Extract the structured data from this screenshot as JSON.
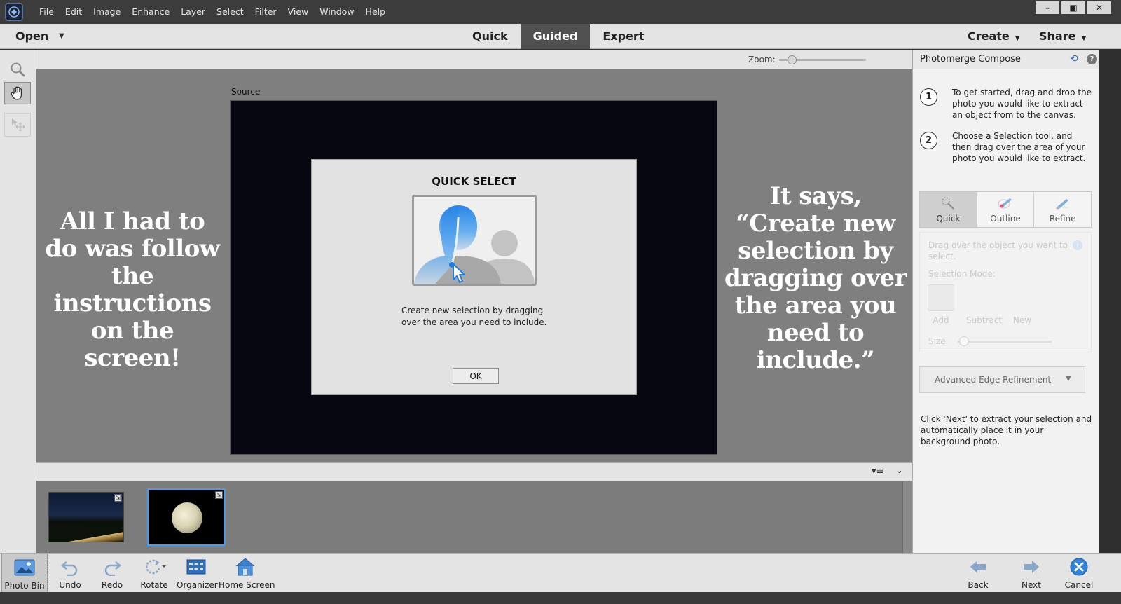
{
  "menubar": {
    "items": [
      "File",
      "Edit",
      "Image",
      "Enhance",
      "Layer",
      "Select",
      "Filter",
      "View",
      "Window",
      "Help"
    ],
    "window_controls": [
      "–",
      "▣",
      "✕"
    ]
  },
  "modebar": {
    "open_label": "Open",
    "modes": [
      "Quick",
      "Guided",
      "Expert"
    ],
    "active_mode": "Guided",
    "create_label": "Create",
    "share_label": "Share"
  },
  "zoom": {
    "label": "Zoom:",
    "level": 0.15
  },
  "canvas": {
    "source_label": "Source",
    "left_note": "All I had to do was follow the instructions on the screen!",
    "right_note": "It says, “Create new selection by dragging over the area you need to include.”"
  },
  "dialog": {
    "title": "QUICK SELECT",
    "message": "Create new selection by dragging over the area you need to include.",
    "ok_label": "OK"
  },
  "panel": {
    "title": "Photomerge Compose",
    "steps": [
      {
        "num": "1",
        "text": "To get started, drag and drop the photo you would like to extract an object from to the canvas."
      },
      {
        "num": "2",
        "text": "Choose a Selection tool, and then drag over the area of your photo you would like to extract."
      }
    ],
    "selection_tabs": [
      "Quick",
      "Outline",
      "Refine"
    ],
    "active_tab": "Quick",
    "hint": "Drag over the object you want to select.",
    "selection_mode_label": "Selection Mode:",
    "modes": [
      "Add",
      "Subtract",
      "New"
    ],
    "size_label": "Size:",
    "advanced_label": "Advanced Edge Refinement",
    "next_note": "Click 'Next' to extract your selection and automatically place it in your background photo."
  },
  "bottombar": {
    "left": [
      "Photo Bin",
      "Undo",
      "Redo",
      "Rotate",
      "Organizer",
      "Home Screen"
    ],
    "right": [
      "Back",
      "Next",
      "Cancel"
    ]
  },
  "colors": {
    "accent": "#2a7fd9",
    "canvas_bg": "#7f7f7f",
    "menubar": "#3c3c3c"
  }
}
